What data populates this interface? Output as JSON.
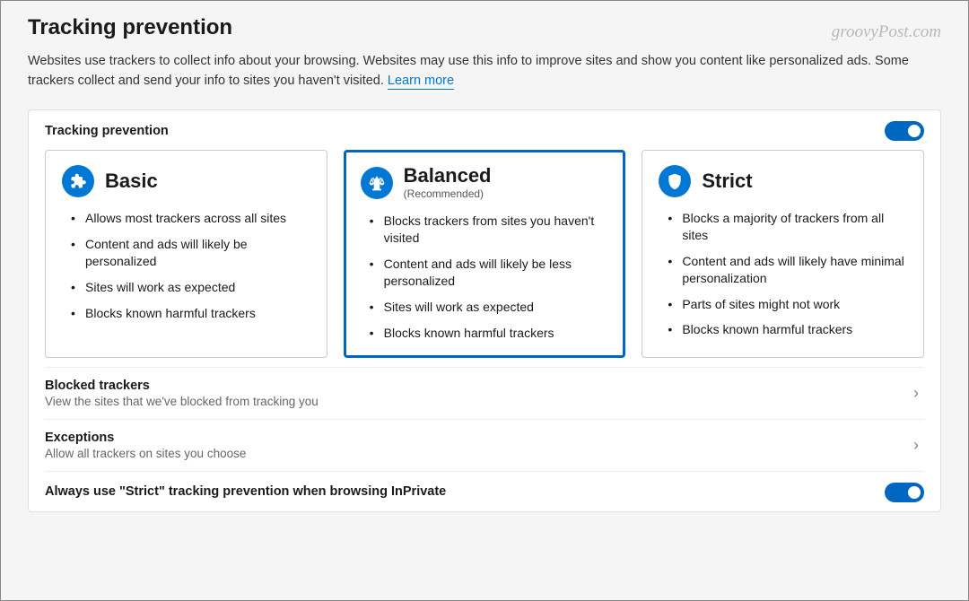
{
  "watermark": "groovyPost.com",
  "header": {
    "title": "Tracking prevention",
    "description_prefix": "Websites use trackers to collect info about your browsing. Websites may use this info to improve sites and show you content like personalized ads. Some trackers collect and send your info to sites you haven't visited. ",
    "learn_more": "Learn more"
  },
  "panel": {
    "title": "Tracking prevention",
    "toggle_on": true
  },
  "cards": {
    "basic": {
      "title": "Basic",
      "subtitle": "",
      "bullets": [
        "Allows most trackers across all sites",
        "Content and ads will likely be personalized",
        "Sites will work as expected",
        "Blocks known harmful trackers"
      ]
    },
    "balanced": {
      "title": "Balanced",
      "subtitle": "(Recommended)",
      "bullets": [
        "Blocks trackers from sites you haven't visited",
        "Content and ads will likely be less personalized",
        "Sites will work as expected",
        "Blocks known harmful trackers"
      ]
    },
    "strict": {
      "title": "Strict",
      "subtitle": "",
      "bullets": [
        "Blocks a majority of trackers from all sites",
        "Content and ads will likely have minimal personalization",
        "Parts of sites might not work",
        "Blocks known harmful trackers"
      ]
    }
  },
  "rows": {
    "blocked": {
      "title": "Blocked trackers",
      "desc": "View the sites that we've blocked from tracking you"
    },
    "exceptions": {
      "title": "Exceptions",
      "desc": "Allow all trackers on sites you choose"
    },
    "inprivate": {
      "title": "Always use \"Strict\" tracking prevention when browsing InPrivate",
      "toggle_on": true
    }
  }
}
